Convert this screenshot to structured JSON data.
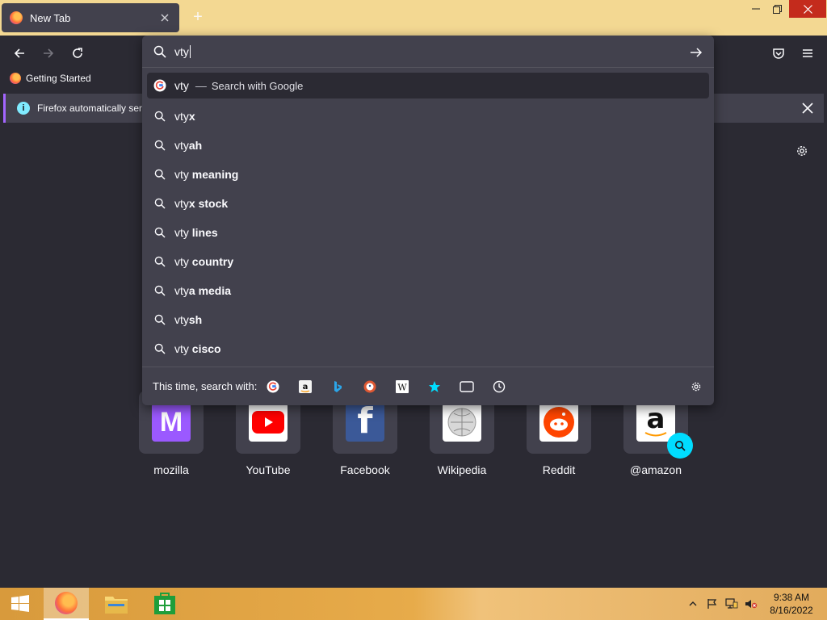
{
  "window": {
    "tab_title": "New Tab",
    "new_tab_glyph": "+",
    "close_glyph": "✕"
  },
  "bookmarks": [
    {
      "label": "Getting Started",
      "icon": "firefox-icon"
    }
  ],
  "notification": {
    "text": "Firefox automatically sen",
    "icon": "info-icon"
  },
  "urlbar": {
    "query": "vty",
    "results": [
      {
        "typed": "vty",
        "suggest": "",
        "separator": "—",
        "action": "Search with Google",
        "icon": "google-icon",
        "selected": true
      },
      {
        "typed": "vty",
        "suggest": "x",
        "icon": "search-icon"
      },
      {
        "typed": "vty",
        "suggest": "ah",
        "icon": "search-icon"
      },
      {
        "typed": "vty",
        "suggest": " meaning",
        "icon": "search-icon"
      },
      {
        "typed": "vty",
        "suggest": "x stock",
        "icon": "search-icon"
      },
      {
        "typed": "vty",
        "suggest": " lines",
        "icon": "search-icon"
      },
      {
        "typed": "vty",
        "suggest": " country",
        "icon": "search-icon"
      },
      {
        "typed": "vty",
        "suggest": "a media",
        "icon": "search-icon"
      },
      {
        "typed": "vty",
        "suggest": "sh",
        "icon": "search-icon"
      },
      {
        "typed": "vty",
        "suggest": " cisco",
        "icon": "search-icon"
      }
    ],
    "oneoff_label": "This time, search with:",
    "oneoff_engines": [
      "google-icon",
      "amazon-icon",
      "bing-icon",
      "duckduckgo-icon",
      "wikipedia-icon",
      "bookmarks-star-icon",
      "tabs-icon",
      "history-icon"
    ]
  },
  "topsites": [
    {
      "label": "mozilla",
      "icon": "mozilla-icon"
    },
    {
      "label": "YouTube",
      "icon": "youtube-icon"
    },
    {
      "label": "Facebook",
      "icon": "facebook-icon"
    },
    {
      "label": "Wikipedia",
      "icon": "wikipedia-icon"
    },
    {
      "label": "Reddit",
      "icon": "reddit-icon"
    },
    {
      "label": "@amazon",
      "icon": "amazon-icon"
    }
  ],
  "taskbar": {
    "items": [
      "start-icon",
      "firefox-icon",
      "file-explorer-icon",
      "store-icon"
    ],
    "clock_time": "9:38 AM",
    "clock_date": "8/16/2022"
  },
  "colors": {
    "accent": "#00ddff",
    "frame": "#f3d892",
    "background": "#2b2a33",
    "panel": "#42414d"
  }
}
